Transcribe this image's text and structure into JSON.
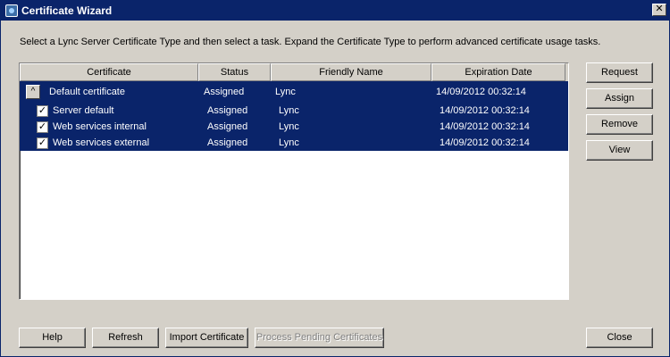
{
  "window": {
    "title": "Certificate Wizard",
    "close_symbol": "✕",
    "icon": "certificate-wizard-icon"
  },
  "instructions": "Select a Lync Server Certificate Type and then select a task. Expand the Certificate Type to perform advanced certificate usage tasks.",
  "table": {
    "columns": [
      "Certificate",
      "Status",
      "Friendly Name",
      "Expiration Date"
    ],
    "group": {
      "expander_symbol": "^",
      "name": "Default certificate",
      "status": "Assigned",
      "friendly_name": "Lync",
      "expiration": "14/09/2012 00:32:14"
    },
    "rows": [
      {
        "name": "Server default",
        "status": "Assigned",
        "friendly_name": "Lync",
        "expiration": "14/09/2012 00:32:14",
        "checked": true
      },
      {
        "name": "Web services internal",
        "status": "Assigned",
        "friendly_name": "Lync",
        "expiration": "14/09/2012 00:32:14",
        "checked": true
      },
      {
        "name": "Web services external",
        "status": "Assigned",
        "friendly_name": "Lync",
        "expiration": "14/09/2012 00:32:14",
        "checked": true
      }
    ],
    "check_symbol": "✓",
    "selection_color": "#0a246a"
  },
  "side_buttons": {
    "request": "Request",
    "assign": "Assign",
    "remove": "Remove",
    "view": "View"
  },
  "bottom_buttons": {
    "help": "Help",
    "refresh": "Refresh",
    "import": "Import Certificate",
    "process_pending": "Process Pending Certificates",
    "close": "Close"
  }
}
